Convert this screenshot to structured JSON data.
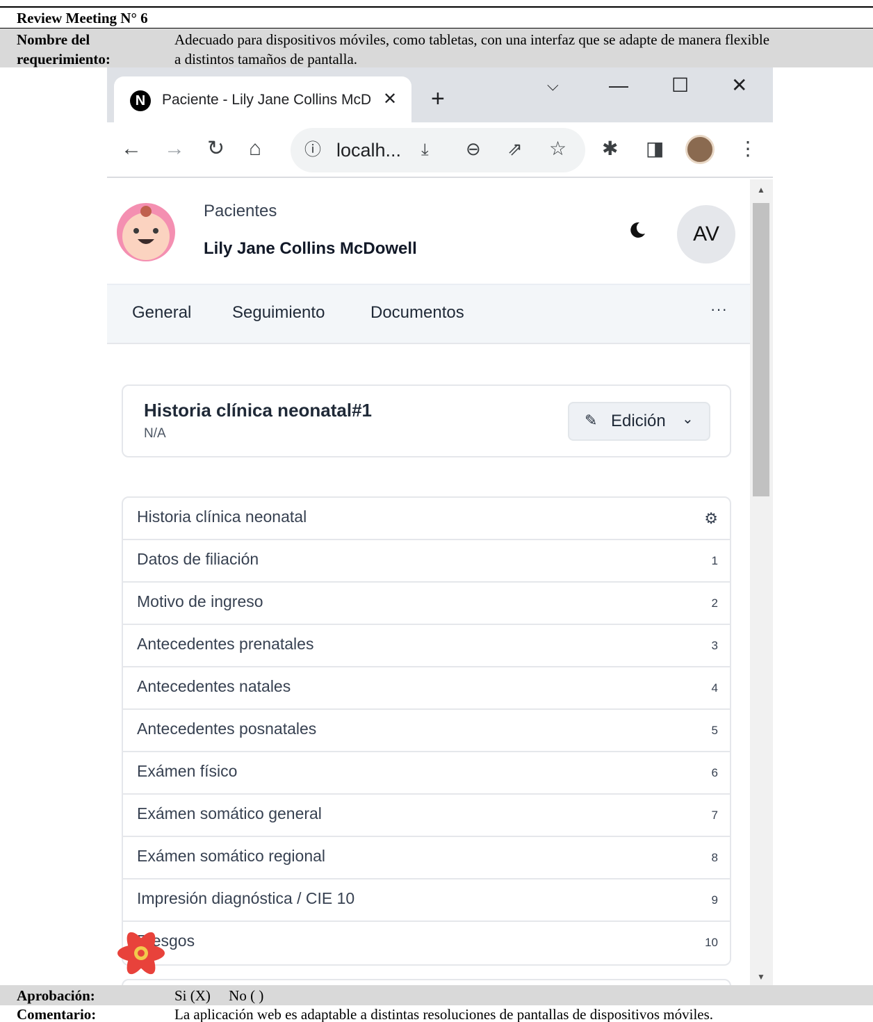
{
  "doc": {
    "title": "Review Meeting N° 6",
    "req_label_line1": "Nombre del",
    "req_label_line2": "requerimiento:",
    "req_text_line1": "Adecuado para dispositivos móviles, como tabletas, con una interfaz que se adapte de manera flexible",
    "req_text_line2": "a distintos tamaños de pantalla.",
    "approval_label": "Aprobación:",
    "approval_value": "Si (X)     No ( )",
    "comment_label": "Comentario:",
    "comment_text": "La aplicación web es adaptable a distintas resoluciones de pantallas de dispositivos móviles."
  },
  "browser": {
    "tab_title": "Paciente - Lily Jane Collins McDowell",
    "favicon_letter": "N",
    "url": "localh..."
  },
  "app": {
    "breadcrumb": "Pacientes",
    "patient_name": "Lily Jane Collins McDowell",
    "user_initials": "AV",
    "tabs": [
      "General",
      "Seguimiento",
      "Documentos"
    ],
    "more": "···",
    "record_title": "Historia clínica neonatal#1",
    "record_subtitle": "N/A",
    "edit_label": "Edición",
    "list_header": "Historia clínica neonatal",
    "sections": [
      {
        "label": "Datos de filiación",
        "num": "1"
      },
      {
        "label": "Motivo de ingreso",
        "num": "2"
      },
      {
        "label": "Antecedentes prenatales",
        "num": "3"
      },
      {
        "label": "Antecedentes natales",
        "num": "4"
      },
      {
        "label": "Antecedentes posnatales",
        "num": "5"
      },
      {
        "label": "Exámen físico",
        "num": "6"
      },
      {
        "label": "Exámen somático general",
        "num": "7"
      },
      {
        "label": "Exámen somático regional",
        "num": "8"
      },
      {
        "label": "Impresión diagnóstica / CIE 10",
        "num": "9"
      },
      {
        "label": "Riesgos",
        "num": "10"
      }
    ]
  },
  "icons": {
    "favicon": "nextjs-icon",
    "settings": "gear-icon",
    "theme": "moon-icon",
    "edit": "edit-icon"
  }
}
